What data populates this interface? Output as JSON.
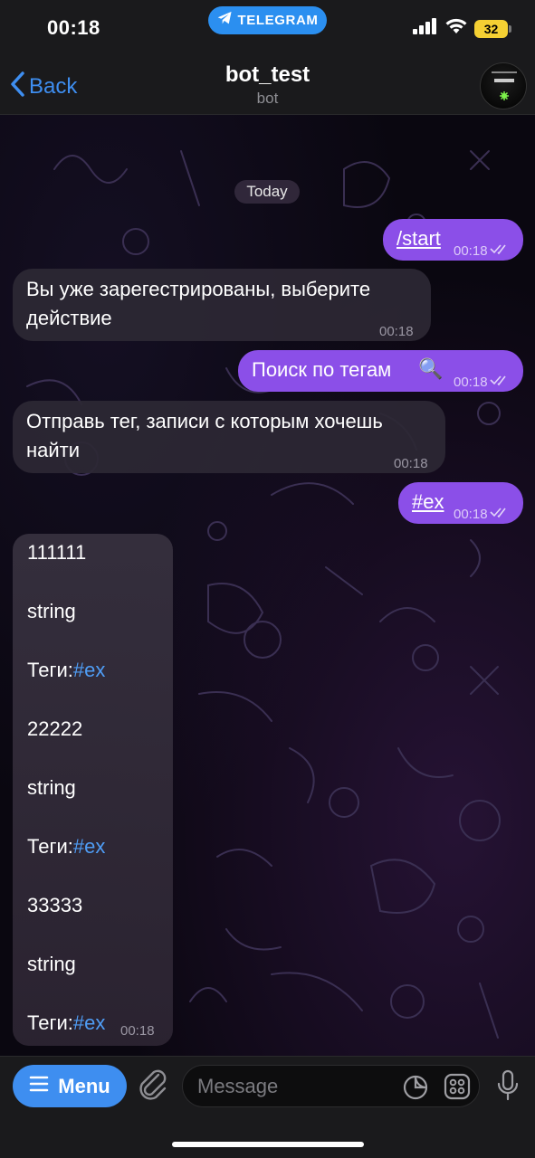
{
  "status_bar": {
    "time": "00:18",
    "app_pill": "TELEGRAM",
    "battery": "32"
  },
  "header": {
    "back_label": "Back",
    "title": "bot_test",
    "subtitle": "bot"
  },
  "chat": {
    "date_label": "Today",
    "messages": [
      {
        "dir": "out",
        "text": "/start",
        "time": "00:18"
      },
      {
        "dir": "in",
        "lines": [
          "Вы уже зарегестрированы, выберите",
          "действие"
        ],
        "time": "00:18"
      },
      {
        "dir": "out",
        "text": "Поиск по тегам",
        "emoji": "🔍",
        "time": "00:18"
      },
      {
        "dir": "in",
        "lines": [
          "Отправь тег, записи с которым хочешь",
          "найти"
        ],
        "time": "00:18"
      },
      {
        "dir": "out",
        "text": "#ex",
        "time": "00:18"
      }
    ],
    "results": {
      "time": "00:18",
      "lines": [
        "111111",
        "string",
        "Теги:",
        "22222",
        "string",
        "Теги:",
        "33333",
        "string",
        "Теги:"
      ],
      "tag": "#ex"
    }
  },
  "input": {
    "menu_label": "Menu",
    "placeholder": "Message"
  },
  "colors": {
    "accent": "#3e8ef0",
    "outgoing": "#8b4fe8",
    "tag": "#4f9df5",
    "battery": "#f5d033"
  }
}
